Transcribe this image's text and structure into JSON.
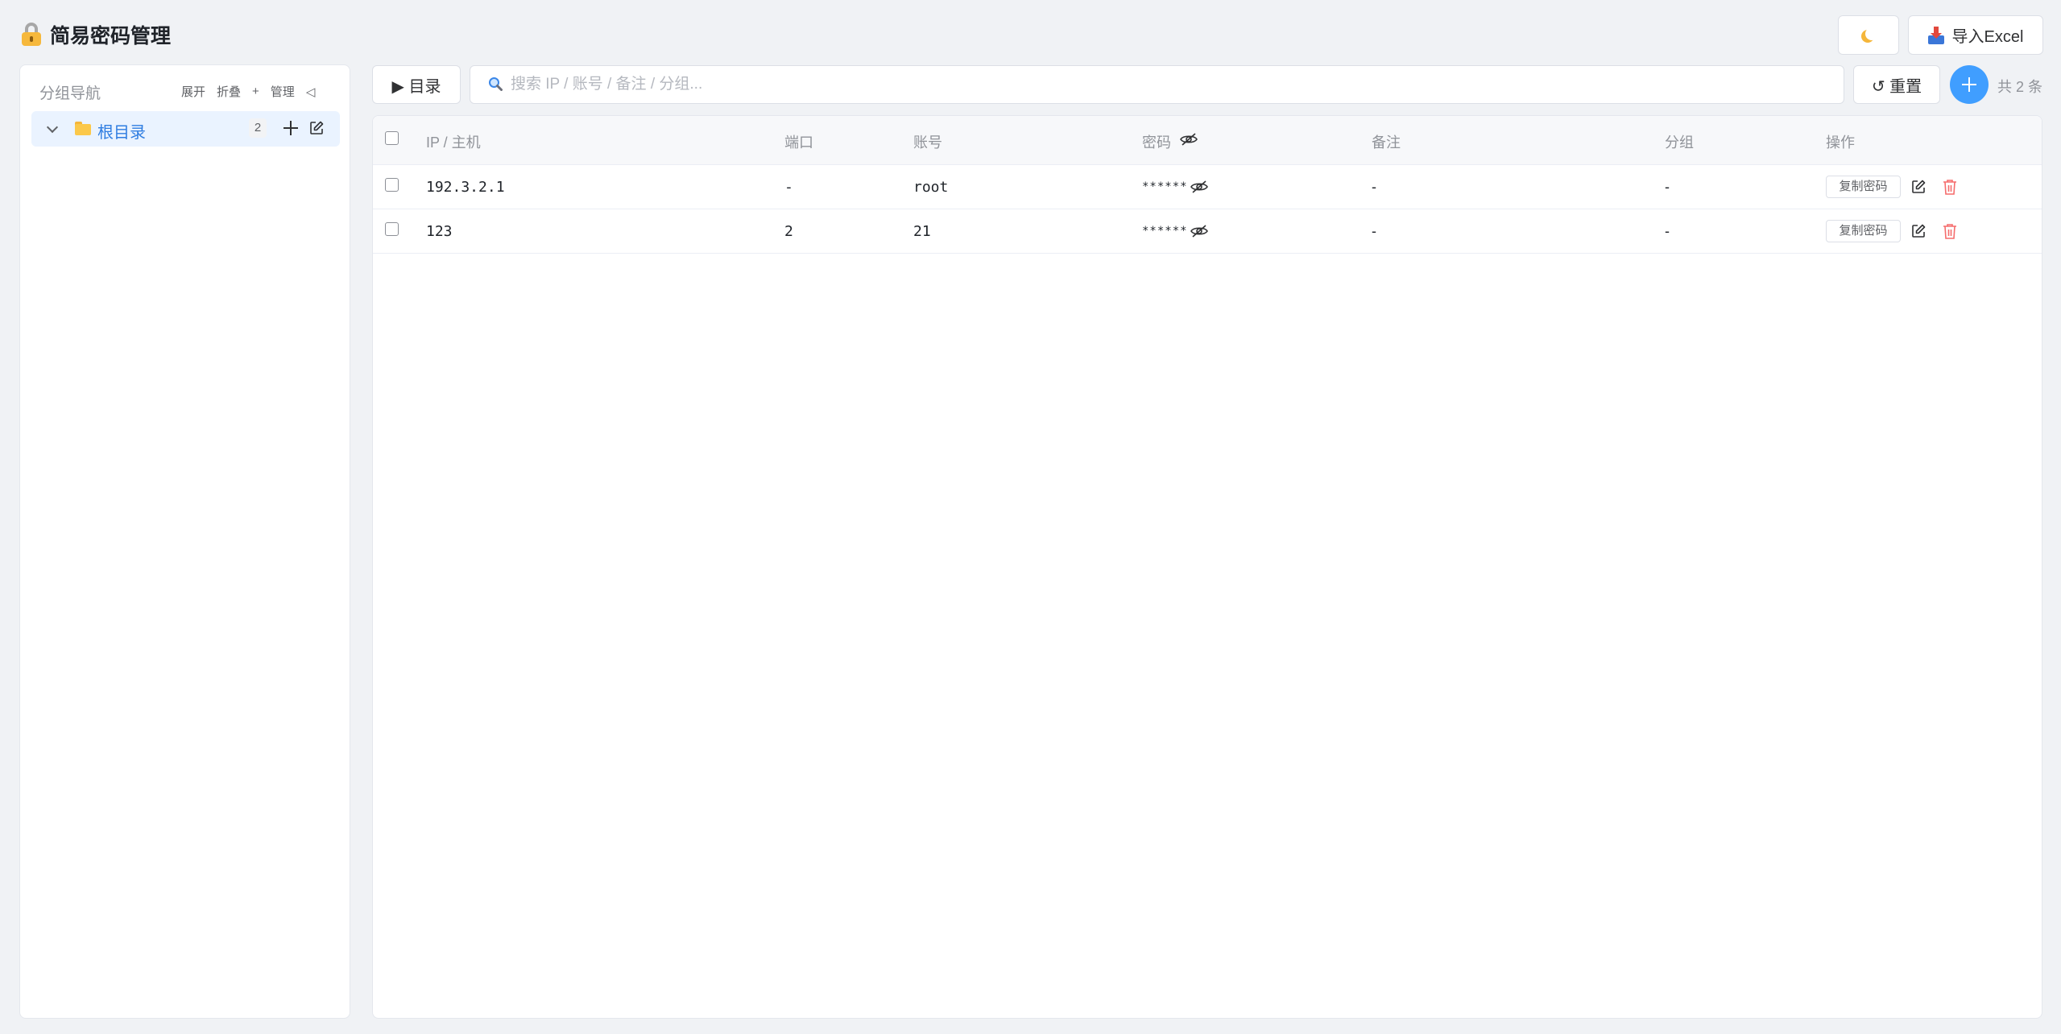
{
  "app": {
    "title": "简易密码管理",
    "lock_icon": "lock-icon"
  },
  "header": {
    "theme_icon": "moon-icon",
    "import_label": "导入Excel",
    "import_icon": "inbox-tray-icon"
  },
  "sidebar": {
    "title": "分组导航",
    "actions": {
      "expand": "展开",
      "collapse": "折叠",
      "add": "+",
      "manage": "管理",
      "hide": "◁"
    },
    "tree": [
      {
        "label": "根目录",
        "count": "2",
        "expanded": true,
        "selected": true
      }
    ]
  },
  "toolbar": {
    "dir_label": "▶ 目录",
    "search_placeholder": "搜索 IP / 账号 / 备注 / 分组...",
    "search_value": "",
    "reset_label": "↺ 重置",
    "add_label": "+",
    "total_label": "共 2 条"
  },
  "table": {
    "columns": [
      "IP / 主机",
      "端口",
      "账号",
      "密码",
      "备注",
      "分组",
      "操作"
    ],
    "rows": [
      {
        "host": "192.3.2.1",
        "port": "-",
        "account": "root",
        "password": "******",
        "note": "-",
        "group": "-",
        "copy_label": "复制密码"
      },
      {
        "host": "123",
        "port": "2",
        "account": "21",
        "password": "******",
        "note": "-",
        "group": "-",
        "copy_label": "复制密码"
      }
    ]
  },
  "colors": {
    "accent": "#409eff",
    "tree_selected_bg": "#eaf3ff",
    "tree_selected_text": "#2f7de1",
    "danger": "#f56c6c",
    "page_bg": "#f0f2f5"
  }
}
